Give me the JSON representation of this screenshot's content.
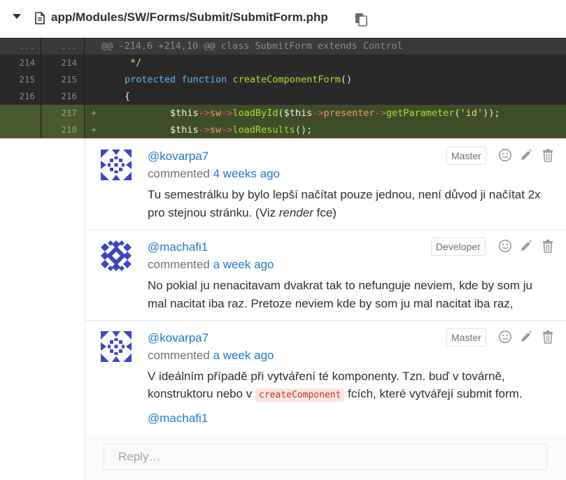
{
  "file": {
    "path": "app/Modules/SW/Forms/Submit/SubmitForm.php"
  },
  "diff": {
    "meta": {
      "old": "...",
      "new": "...",
      "text": "@@ -214,6 +214,10 @@ class SubmitForm extends Control"
    },
    "rows": [
      {
        "old": "214",
        "new": "214"
      },
      {
        "old": "215",
        "new": "215"
      },
      {
        "old": "216",
        "new": "216"
      },
      {
        "old": "",
        "new": "217",
        "sign": "+"
      },
      {
        "old": "",
        "new": "218",
        "sign": "+"
      }
    ],
    "tokens": {
      "r1": "*/",
      "r2_kw": "protected function",
      "r2_fn": "createComponentForm",
      "r2_rest": "()",
      "r3": "{",
      "this": "$this",
      "arrow": "->",
      "sw": "sw",
      "loadById": "loadById",
      "open": "(",
      "presenter": "presenter",
      "getParameter": "getParameter",
      "str_id": "'id'",
      "close1": "));",
      "loadResults": "loadResults",
      "close2": "();"
    }
  },
  "comments": [
    {
      "author": "@kovarpa7",
      "commented": "commented",
      "time": "4 weeks ago",
      "role": "Master",
      "line1": "Tu semestrálku by bylo lepší načítat pouze jednou, není důvod ji načítat 2x",
      "line2_a": "pro stejnou stránku. (Viz ",
      "line2_em": "render",
      "line2_b": " fce)"
    },
    {
      "author": "@machafi1",
      "commented": "commented",
      "time": "a week ago",
      "role": "Developer",
      "line1": "No pokial ju nenacitavam dvakrat tak to nefunguje neviem, kde by som ju",
      "line2": "mal nacitat iba raz. Pretoze neviem kde by som ju mal nacitat iba raz,"
    },
    {
      "author": "@kovarpa7",
      "commented": "commented",
      "time": "a week ago",
      "role": "Master",
      "line1": "V ideálním případě při vytváření té komponenty. Tzn. buď v továrně,",
      "line2_a": "konstruktoru nebo v ",
      "line2_code": "createComponent",
      "line2_b": " fcích, které vytvářejí submit form.",
      "mention": "@machafi1"
    }
  ],
  "reply": {
    "placeholder": "Reply…"
  },
  "icons": {
    "emoji": "smiley-icon",
    "edit": "pencil-icon",
    "delete": "trash-icon",
    "copy": "copy-icon",
    "file": "file-icon",
    "collapse": "chevron-down-icon"
  },
  "colors": {
    "link": "#1f78d1",
    "added_bg": "#3f4d27",
    "code_bg": "#29292a"
  }
}
